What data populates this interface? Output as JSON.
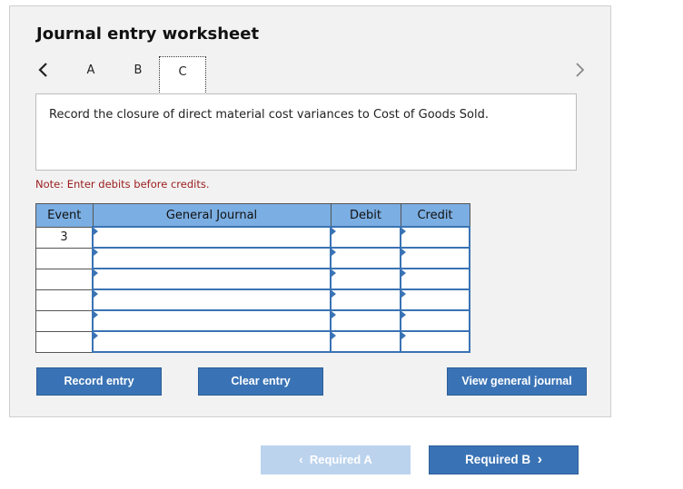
{
  "header": {
    "title": "Journal entry worksheet"
  },
  "tabs": [
    {
      "label": "A"
    },
    {
      "label": "B"
    },
    {
      "label": "C"
    }
  ],
  "instruction": "Record the closure of direct material cost variances to Cost of Goods Sold.",
  "note": "Note: Enter debits before credits.",
  "table": {
    "headers": [
      "Event",
      "General Journal",
      "Debit",
      "Credit"
    ],
    "rows": [
      {
        "event": "3",
        "general_journal": "",
        "debit": "",
        "credit": ""
      },
      {
        "event": "",
        "general_journal": "",
        "debit": "",
        "credit": ""
      },
      {
        "event": "",
        "general_journal": "",
        "debit": "",
        "credit": ""
      },
      {
        "event": "",
        "general_journal": "",
        "debit": "",
        "credit": ""
      },
      {
        "event": "",
        "general_journal": "",
        "debit": "",
        "credit": ""
      },
      {
        "event": "",
        "general_journal": "",
        "debit": "",
        "credit": ""
      }
    ]
  },
  "buttons": {
    "record": "Record entry",
    "clear": "Clear entry",
    "view": "View general journal",
    "required_a": "Required A",
    "required_b": "Required B"
  },
  "icons": {
    "prev": "chevron-left-icon",
    "next": "chevron-right-icon"
  },
  "colors": {
    "accent": "#3a73b5",
    "header_bg": "#7baee2",
    "note": "#9b1c1c",
    "disabled": "#bcd3ee"
  }
}
